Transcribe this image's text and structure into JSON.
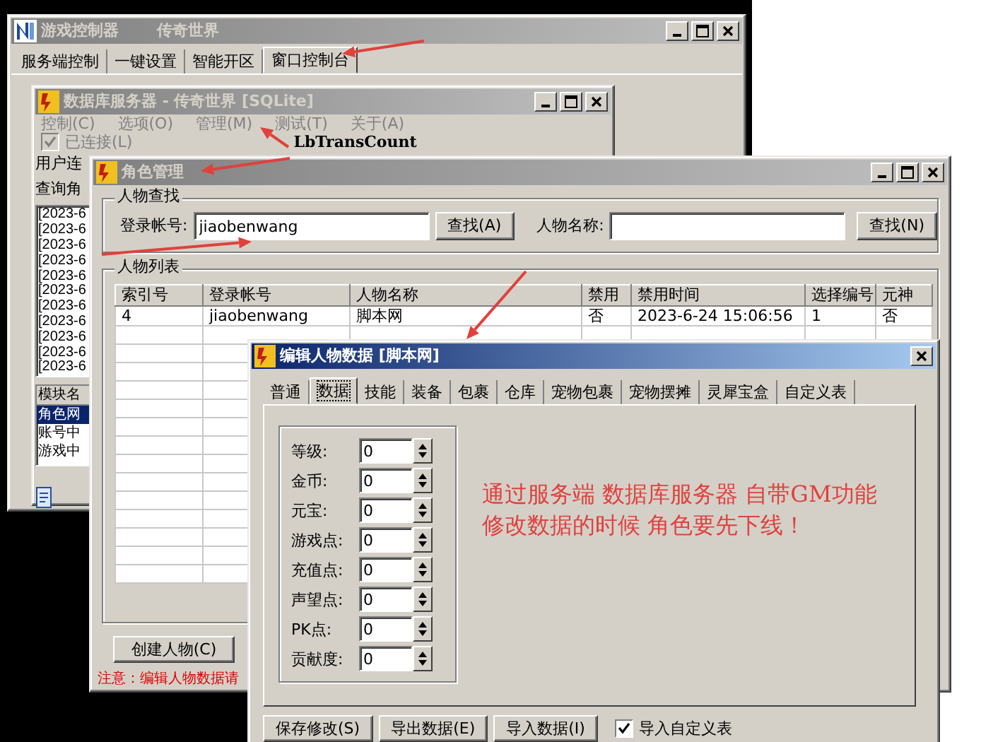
{
  "controller_window": {
    "title": "游戏控制器",
    "subtitle": "传奇世界",
    "tabs": [
      {
        "label": "服务端控制",
        "selected": false
      },
      {
        "label": "一键设置",
        "selected": false
      },
      {
        "label": "智能开区",
        "selected": false
      },
      {
        "label": "窗口控制台",
        "selected": true
      }
    ]
  },
  "db_server_window": {
    "title": "数据库服务器 - 传奇世界 [SQLite]",
    "menu": [
      "控制(C)",
      "选项(O)",
      "管理(M)",
      "测试(T)",
      "关于(A)"
    ],
    "connected": {
      "label": "已连接(L)",
      "checked": true,
      "disabled": true
    },
    "trans_count": "LbTransCount",
    "labels": [
      "用户连",
      "查询角"
    ],
    "log_lines": [
      "[2023-6",
      "[2023-6",
      "[2023-6",
      "[2023-6",
      "[2023-6",
      "[2023-6",
      "[2023-6",
      "[2023-6",
      "[2023-6",
      "[2023-6",
      "[2023-6"
    ],
    "modules": {
      "header": "模块名",
      "items": [
        {
          "label": "角色网",
          "selected": true
        },
        {
          "label": "账号中",
          "selected": false
        },
        {
          "label": "游戏中",
          "selected": false
        }
      ]
    }
  },
  "role_window": {
    "title": "角色管理",
    "search_group": {
      "title": "人物查找",
      "account_label": "登录帐号:",
      "account_value": "jiaobenwang",
      "account_button": "查找(A)",
      "name_label": "人物名称:",
      "name_button": "查找(N)"
    },
    "list_group": {
      "title": "人物列表",
      "columns": [
        "索引号",
        "登录帐号",
        "人物名称",
        "禁用",
        "禁用时间",
        "选择编号",
        "元神"
      ],
      "rows": [
        [
          "4",
          "jiaobenwang",
          "脚本网",
          "否",
          "2023-6-24 15:06:56",
          "1",
          "否"
        ]
      ]
    },
    "create_button": "创建人物(C)",
    "note": "注意：编辑人物数据请"
  },
  "edit_dialog": {
    "title": "编辑人物数据 [脚本网]",
    "tabs": [
      {
        "label": "普通",
        "selected": false
      },
      {
        "label": "数据",
        "selected": true
      },
      {
        "label": "技能",
        "selected": false
      },
      {
        "label": "装备",
        "selected": false
      },
      {
        "label": "包裹",
        "selected": false
      },
      {
        "label": "仓库",
        "selected": false
      },
      {
        "label": "宠物包裹",
        "selected": false
      },
      {
        "label": "宠物摆摊",
        "selected": false
      },
      {
        "label": "灵犀宝盒",
        "selected": false
      },
      {
        "label": "自定义表",
        "selected": false
      }
    ],
    "fields": [
      {
        "label": "等级:",
        "value": "0"
      },
      {
        "label": "金币:",
        "value": "0"
      },
      {
        "label": "元宝:",
        "value": "0"
      },
      {
        "label": "游戏点:",
        "value": "0"
      },
      {
        "label": "充值点:",
        "value": "0"
      },
      {
        "label": "声望点:",
        "value": "0"
      },
      {
        "label": "PK点:",
        "value": "0"
      },
      {
        "label": "贡献度:",
        "value": "0"
      }
    ],
    "annotation": [
      "通过服务端 数据库服务器 自带GM功能",
      "修改数据的时候 角色要先下线！"
    ],
    "buttons": [
      "保存修改(S)",
      "导出数据(E)",
      "导入数据(I)"
    ],
    "import_custom": {
      "label": "导入自定义表",
      "checked": true
    }
  }
}
